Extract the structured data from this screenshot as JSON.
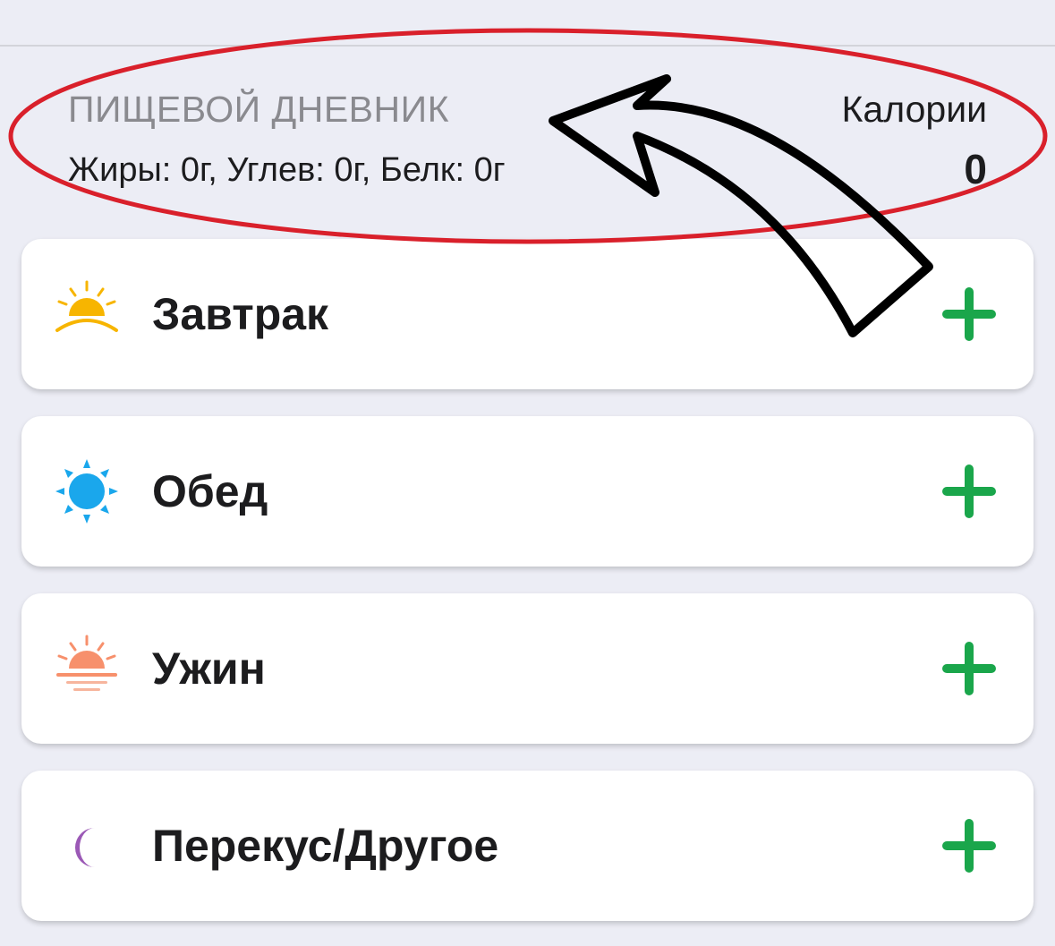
{
  "diary": {
    "title": "ПИЩЕВОЙ ДНЕВНИК",
    "macros": "Жиры: 0г, Углев: 0г, Белк: 0г",
    "calories_label": "Калории",
    "calories_value": "0"
  },
  "meals": [
    {
      "name": "Завтрак",
      "icon": "sunrise-icon"
    },
    {
      "name": "Обед",
      "icon": "sun-icon"
    },
    {
      "name": "Ужин",
      "icon": "sunset-icon"
    },
    {
      "name": "Перекус/Другое",
      "icon": "moon-icon"
    }
  ],
  "colors": {
    "background": "#ecedf5",
    "add_button": "#1aa64b",
    "annotation_ellipse": "#d9202b",
    "annotation_arrow": "#000000",
    "sunrise": "#f7b500",
    "sun": "#1aa7ec",
    "sunset": "#f7906c",
    "moon": "#9b59b6"
  }
}
